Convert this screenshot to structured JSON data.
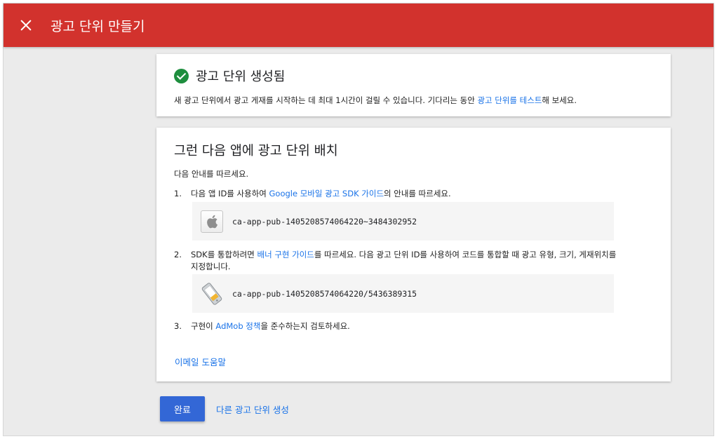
{
  "header": {
    "title": "광고 단위 만들기"
  },
  "created_card": {
    "title": "광고 단위 생성됨",
    "desc_before": "새 광고 단위에서 광고 게재를 시작하는 데 최대 1시간이 걸릴 수 있습니다. 기다리는 동안 ",
    "desc_link": "광고 단위를 테스트",
    "desc_after": "해 보세요."
  },
  "placement_card": {
    "title": "그런 다음 앱에 광고 단위 배치",
    "intro": "다음 안내를 따르세요.",
    "steps": [
      {
        "num": "1.",
        "before": "다음 앱 ID를 사용하여 ",
        "link": "Google 모바일 광고 SDK 가이드",
        "after": "의 안내를 따르세요.",
        "id_value": "ca-app-pub-1405208574064220~3484302952",
        "icon": "apple-icon"
      },
      {
        "num": "2.",
        "before": "SDK를 통합하려면 ",
        "link": "배너 구현 가이드",
        "after": "를 따르세요. 다음 광고 단위 ID를 사용하여 코드를 통합할 때 광고 유형, 크기, 게재위치를 지정합니다.",
        "id_value": "ca-app-pub-1405208574064220/5436389315",
        "icon": "banner-ad-icon"
      },
      {
        "num": "3.",
        "before": "구현이 ",
        "link": "AdMob 정책",
        "after": "을 준수하는지 검토하세요."
      }
    ],
    "email_help": "이메일 도움말"
  },
  "actions": {
    "done": "완료",
    "create_another": "다른 광고 단위 생성"
  },
  "colors": {
    "header_bg": "#d2322d",
    "link": "#1a73e8",
    "primary_button": "#3367d6",
    "success": "#1e8e3e"
  }
}
